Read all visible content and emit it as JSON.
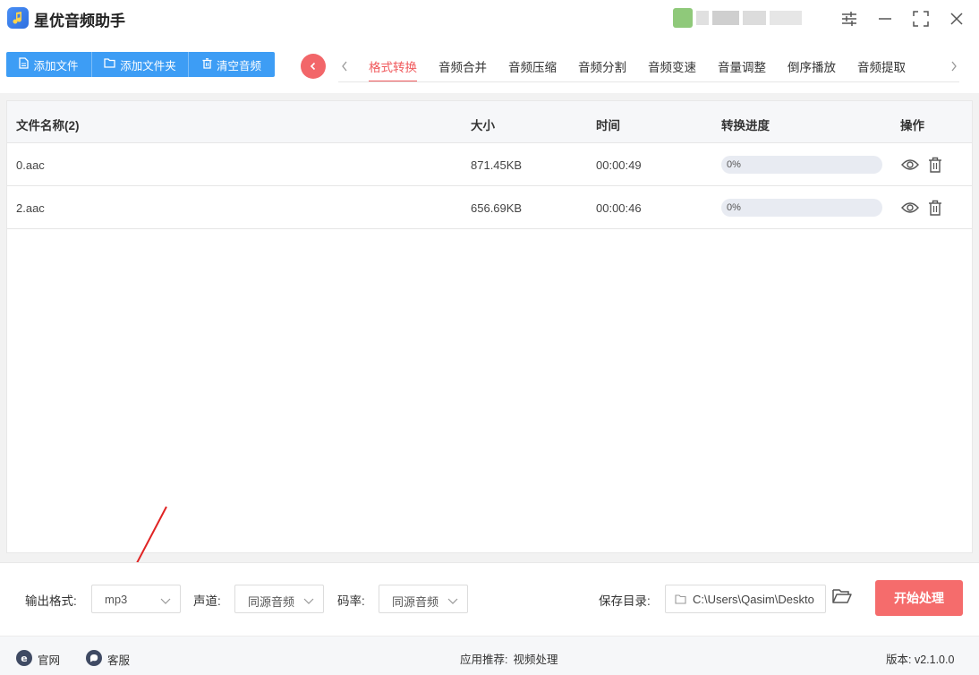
{
  "app": {
    "title": "星优音频助手"
  },
  "toolbar": {
    "buttons": [
      {
        "label": "添加文件",
        "icon": "file-icon"
      },
      {
        "label": "添加文件夹",
        "icon": "folder-icon"
      },
      {
        "label": "清空音频",
        "icon": "trash-icon"
      }
    ]
  },
  "tabs": [
    {
      "label": "格式转换",
      "active": true
    },
    {
      "label": "音频合并"
    },
    {
      "label": "音频压缩"
    },
    {
      "label": "音频分割"
    },
    {
      "label": "音频变速"
    },
    {
      "label": "音量调整"
    },
    {
      "label": "倒序播放"
    },
    {
      "label": "音频提取"
    }
  ],
  "table": {
    "headers": {
      "name": "文件名称(2)",
      "size": "大小",
      "time": "时间",
      "progress": "转换进度",
      "actions": "操作"
    },
    "rows": [
      {
        "name": "0.aac",
        "size": "871.45KB",
        "time": "00:00:49",
        "progress": "0%",
        "progress_value": 0
      },
      {
        "name": "2.aac",
        "size": "656.69KB",
        "time": "00:00:46",
        "progress": "0%",
        "progress_value": 0
      }
    ]
  },
  "settings": {
    "format_label": "输出格式:",
    "format_value": "mp3",
    "channel_label": "声道:",
    "channel_value": "同源音频",
    "bitrate_label": "码率:",
    "bitrate_value": "同源音频",
    "save_label": "保存目录:",
    "save_path": "C:\\Users\\Qasim\\Desktop",
    "start_label": "开始处理"
  },
  "status": {
    "website": "官网",
    "support": "客服",
    "recommend_label": "应用推荐:",
    "recommend_value": "视频处理",
    "version": "版本: v2.1.0.0"
  },
  "colors": {
    "accent_blue": "#3d9df5",
    "accent_red": "#f05a5d",
    "start_button": "#f56c6c"
  }
}
